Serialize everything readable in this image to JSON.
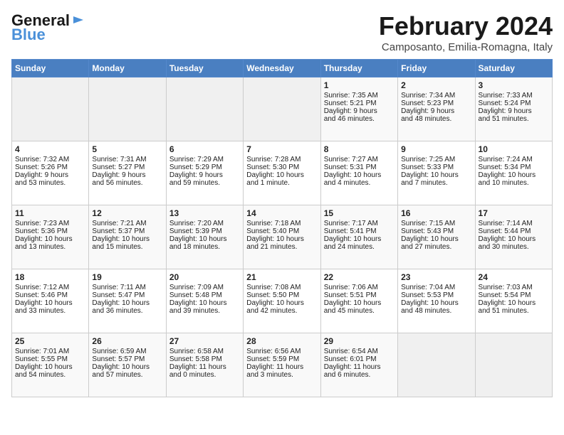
{
  "header": {
    "logo_line1": "General",
    "logo_line2": "Blue",
    "month": "February 2024",
    "location": "Camposanto, Emilia-Romagna, Italy"
  },
  "days_of_week": [
    "Sunday",
    "Monday",
    "Tuesday",
    "Wednesday",
    "Thursday",
    "Friday",
    "Saturday"
  ],
  "weeks": [
    [
      {
        "day": "",
        "data": ""
      },
      {
        "day": "",
        "data": ""
      },
      {
        "day": "",
        "data": ""
      },
      {
        "day": "",
        "data": ""
      },
      {
        "day": "1",
        "data": "Sunrise: 7:35 AM\nSunset: 5:21 PM\nDaylight: 9 hours\nand 46 minutes."
      },
      {
        "day": "2",
        "data": "Sunrise: 7:34 AM\nSunset: 5:23 PM\nDaylight: 9 hours\nand 48 minutes."
      },
      {
        "day": "3",
        "data": "Sunrise: 7:33 AM\nSunset: 5:24 PM\nDaylight: 9 hours\nand 51 minutes."
      }
    ],
    [
      {
        "day": "4",
        "data": "Sunrise: 7:32 AM\nSunset: 5:26 PM\nDaylight: 9 hours\nand 53 minutes."
      },
      {
        "day": "5",
        "data": "Sunrise: 7:31 AM\nSunset: 5:27 PM\nDaylight: 9 hours\nand 56 minutes."
      },
      {
        "day": "6",
        "data": "Sunrise: 7:29 AM\nSunset: 5:29 PM\nDaylight: 9 hours\nand 59 minutes."
      },
      {
        "day": "7",
        "data": "Sunrise: 7:28 AM\nSunset: 5:30 PM\nDaylight: 10 hours\nand 1 minute."
      },
      {
        "day": "8",
        "data": "Sunrise: 7:27 AM\nSunset: 5:31 PM\nDaylight: 10 hours\nand 4 minutes."
      },
      {
        "day": "9",
        "data": "Sunrise: 7:25 AM\nSunset: 5:33 PM\nDaylight: 10 hours\nand 7 minutes."
      },
      {
        "day": "10",
        "data": "Sunrise: 7:24 AM\nSunset: 5:34 PM\nDaylight: 10 hours\nand 10 minutes."
      }
    ],
    [
      {
        "day": "11",
        "data": "Sunrise: 7:23 AM\nSunset: 5:36 PM\nDaylight: 10 hours\nand 13 minutes."
      },
      {
        "day": "12",
        "data": "Sunrise: 7:21 AM\nSunset: 5:37 PM\nDaylight: 10 hours\nand 15 minutes."
      },
      {
        "day": "13",
        "data": "Sunrise: 7:20 AM\nSunset: 5:39 PM\nDaylight: 10 hours\nand 18 minutes."
      },
      {
        "day": "14",
        "data": "Sunrise: 7:18 AM\nSunset: 5:40 PM\nDaylight: 10 hours\nand 21 minutes."
      },
      {
        "day": "15",
        "data": "Sunrise: 7:17 AM\nSunset: 5:41 PM\nDaylight: 10 hours\nand 24 minutes."
      },
      {
        "day": "16",
        "data": "Sunrise: 7:15 AM\nSunset: 5:43 PM\nDaylight: 10 hours\nand 27 minutes."
      },
      {
        "day": "17",
        "data": "Sunrise: 7:14 AM\nSunset: 5:44 PM\nDaylight: 10 hours\nand 30 minutes."
      }
    ],
    [
      {
        "day": "18",
        "data": "Sunrise: 7:12 AM\nSunset: 5:46 PM\nDaylight: 10 hours\nand 33 minutes."
      },
      {
        "day": "19",
        "data": "Sunrise: 7:11 AM\nSunset: 5:47 PM\nDaylight: 10 hours\nand 36 minutes."
      },
      {
        "day": "20",
        "data": "Sunrise: 7:09 AM\nSunset: 5:48 PM\nDaylight: 10 hours\nand 39 minutes."
      },
      {
        "day": "21",
        "data": "Sunrise: 7:08 AM\nSunset: 5:50 PM\nDaylight: 10 hours\nand 42 minutes."
      },
      {
        "day": "22",
        "data": "Sunrise: 7:06 AM\nSunset: 5:51 PM\nDaylight: 10 hours\nand 45 minutes."
      },
      {
        "day": "23",
        "data": "Sunrise: 7:04 AM\nSunset: 5:53 PM\nDaylight: 10 hours\nand 48 minutes."
      },
      {
        "day": "24",
        "data": "Sunrise: 7:03 AM\nSunset: 5:54 PM\nDaylight: 10 hours\nand 51 minutes."
      }
    ],
    [
      {
        "day": "25",
        "data": "Sunrise: 7:01 AM\nSunset: 5:55 PM\nDaylight: 10 hours\nand 54 minutes."
      },
      {
        "day": "26",
        "data": "Sunrise: 6:59 AM\nSunset: 5:57 PM\nDaylight: 10 hours\nand 57 minutes."
      },
      {
        "day": "27",
        "data": "Sunrise: 6:58 AM\nSunset: 5:58 PM\nDaylight: 11 hours\nand 0 minutes."
      },
      {
        "day": "28",
        "data": "Sunrise: 6:56 AM\nSunset: 5:59 PM\nDaylight: 11 hours\nand 3 minutes."
      },
      {
        "day": "29",
        "data": "Sunrise: 6:54 AM\nSunset: 6:01 PM\nDaylight: 11 hours\nand 6 minutes."
      },
      {
        "day": "",
        "data": ""
      },
      {
        "day": "",
        "data": ""
      }
    ]
  ]
}
